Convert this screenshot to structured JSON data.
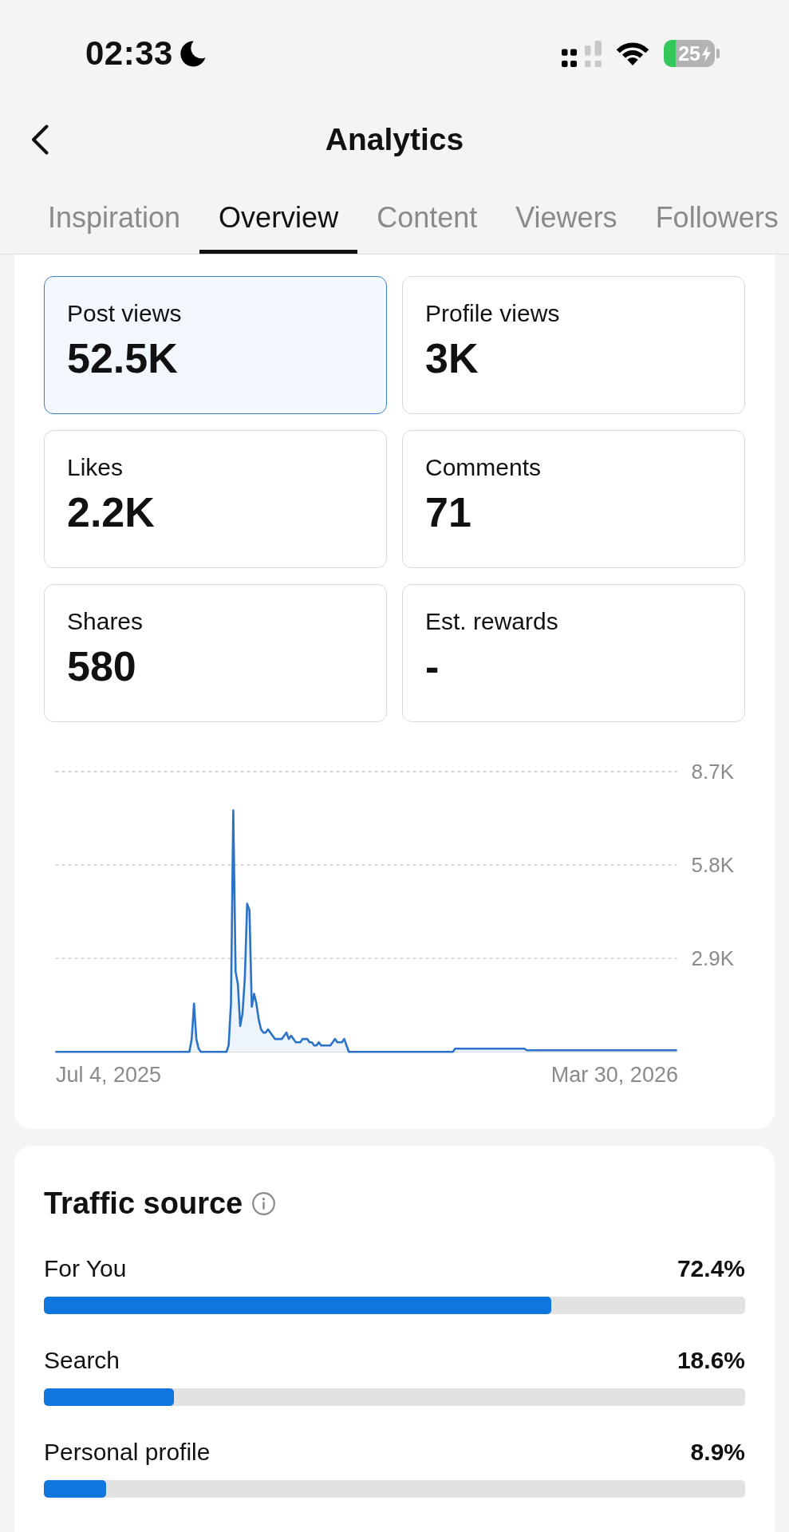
{
  "status_bar": {
    "time": "02:33",
    "battery": "25"
  },
  "header": {
    "title": "Analytics"
  },
  "tabs": [
    {
      "label": "Inspiration",
      "selected": false
    },
    {
      "label": "Overview",
      "selected": true
    },
    {
      "label": "Content",
      "selected": false
    },
    {
      "label": "Viewers",
      "selected": false
    },
    {
      "label": "Followers",
      "selected": false
    }
  ],
  "overview": {
    "metrics": [
      {
        "label": "Post views",
        "value": "52.5K",
        "selected": true
      },
      {
        "label": "Profile views",
        "value": "3K",
        "selected": false
      },
      {
        "label": "Likes",
        "value": "2.2K",
        "selected": false
      },
      {
        "label": "Comments",
        "value": "71",
        "selected": false
      },
      {
        "label": "Shares",
        "value": "580",
        "selected": false
      },
      {
        "label": "Est. rewards",
        "value": "-",
        "selected": false
      }
    ],
    "chart_data": {
      "type": "area",
      "categories": [
        null,
        null,
        null,
        null,
        null,
        null,
        null,
        null,
        null,
        null,
        null,
        null,
        null,
        null,
        null,
        null,
        null,
        null,
        null,
        null,
        null,
        null,
        null,
        "Jul 4, 2025",
        null,
        null,
        null,
        null,
        null,
        null,
        null,
        null,
        null,
        null,
        null,
        null,
        null,
        null,
        null,
        null,
        null,
        null,
        null,
        null,
        null,
        null,
        null,
        null,
        null,
        null,
        null,
        null,
        null,
        null,
        null,
        null,
        null,
        null,
        null,
        null,
        null,
        null,
        null,
        null,
        null,
        null,
        null,
        null,
        null,
        null,
        null,
        null,
        null,
        null,
        null,
        null,
        null,
        null,
        null,
        null,
        null,
        null,
        null,
        null,
        null,
        null,
        null,
        null,
        null,
        null,
        null,
        null,
        null,
        null,
        null,
        null,
        null,
        null,
        null,
        null,
        null,
        null,
        null,
        null,
        null,
        null,
        null,
        null,
        null,
        null,
        null,
        null,
        null,
        null,
        null,
        null,
        null,
        null,
        null,
        null,
        null,
        null,
        null,
        null,
        null,
        null,
        null,
        null,
        null,
        null,
        null,
        null,
        null,
        null,
        null,
        null,
        null,
        null,
        null,
        null,
        null,
        null,
        null,
        null,
        null,
        null,
        null,
        null,
        null,
        null,
        null,
        null,
        null,
        null,
        null,
        null,
        null,
        null,
        null,
        null,
        null,
        null,
        null,
        null,
        null,
        null,
        null,
        null,
        null,
        null,
        null,
        null,
        null,
        null,
        null,
        null,
        null,
        null,
        null,
        null,
        null,
        null,
        null,
        null,
        null,
        null,
        null,
        null,
        null,
        null,
        null,
        null,
        null,
        null,
        null,
        null,
        null,
        null,
        null,
        null,
        null,
        null,
        null,
        null,
        null,
        null,
        null,
        null,
        null,
        null,
        null,
        null,
        null,
        null,
        null,
        null,
        null,
        null,
        null,
        null,
        null,
        null,
        null,
        null,
        null,
        null,
        null,
        null,
        null,
        null,
        null,
        null,
        null,
        null,
        null,
        null,
        null,
        null,
        null,
        null,
        null,
        null,
        "Mar 30, 2026",
        null,
        null,
        null,
        null,
        null,
        null,
        null,
        null,
        null,
        null,
        null,
        null,
        null,
        null,
        null,
        null,
        null,
        null,
        null,
        null,
        null,
        null,
        null,
        null,
        null,
        null,
        null
      ],
      "values": [
        0,
        0,
        0,
        0,
        0,
        0,
        0,
        0,
        0,
        0,
        0,
        0,
        0,
        0,
        0,
        0,
        0,
        0,
        0,
        0,
        0,
        0,
        0,
        0,
        0,
        0,
        0,
        0,
        0,
        0,
        0,
        0,
        0,
        0,
        0,
        0,
        0,
        0,
        0,
        0,
        0,
        0,
        0,
        0,
        0,
        0,
        0,
        0,
        0,
        0,
        0,
        0,
        0,
        0,
        0,
        0,
        0,
        0,
        0,
        400,
        1500,
        400,
        100,
        0,
        0,
        0,
        0,
        0,
        0,
        0,
        0,
        0,
        0,
        0,
        0,
        200,
        1500,
        7500,
        2500,
        2100,
        800,
        1200,
        2300,
        4600,
        4400,
        1400,
        1800,
        1500,
        1000,
        700,
        600,
        600,
        700,
        600,
        500,
        400,
        400,
        400,
        400,
        500,
        600,
        400,
        500,
        400,
        300,
        300,
        300,
        400,
        400,
        400,
        300,
        300,
        200,
        200,
        300,
        200,
        200,
        200,
        200,
        200,
        300,
        400,
        300,
        300,
        300,
        400,
        200,
        0,
        0,
        0,
        0,
        0,
        0,
        0,
        0,
        0,
        0,
        0,
        0,
        0,
        0,
        0,
        0,
        0,
        0,
        0,
        0,
        0,
        0,
        0,
        0,
        0,
        0,
        0,
        0,
        0,
        0,
        0,
        0,
        0,
        0,
        0,
        0,
        0,
        0,
        0,
        0,
        0,
        0,
        0,
        0,
        0,
        0,
        100,
        100,
        100,
        100,
        100,
        100,
        100,
        100,
        100,
        100,
        100,
        100,
        100,
        100,
        100,
        100,
        100,
        100,
        100,
        100,
        100,
        100,
        100,
        100,
        100,
        100,
        100,
        100,
        100,
        100,
        100,
        50,
        50,
        50,
        50,
        50,
        50,
        50,
        50,
        50,
        50,
        50,
        50,
        50,
        50,
        50,
        50,
        50,
        50,
        50,
        50,
        50,
        50,
        50,
        50,
        50,
        50,
        50,
        50,
        50,
        50,
        50,
        50,
        50,
        50,
        50,
        50,
        50,
        50,
        50,
        50,
        50,
        50,
        50,
        50,
        50,
        50,
        50,
        50,
        50,
        50,
        50,
        50,
        50,
        50,
        50,
        50,
        50,
        50,
        50,
        50,
        50,
        50,
        50,
        50,
        50,
        50
      ],
      "ylim": [
        0,
        8700
      ],
      "yticks": [
        {
          "value": 2900,
          "label": "2.9K"
        },
        {
          "value": 5800,
          "label": "5.8K"
        },
        {
          "value": 8700,
          "label": "8.7K"
        }
      ]
    }
  },
  "traffic_source": {
    "title": "Traffic source",
    "sources": [
      {
        "name": "For You",
        "share": "72.4%",
        "level": 0.724
      },
      {
        "name": "Search",
        "share": "18.6%",
        "level": 0.186
      },
      {
        "name": "Personal profile",
        "share": "8.9%",
        "level": 0.089
      }
    ]
  }
}
